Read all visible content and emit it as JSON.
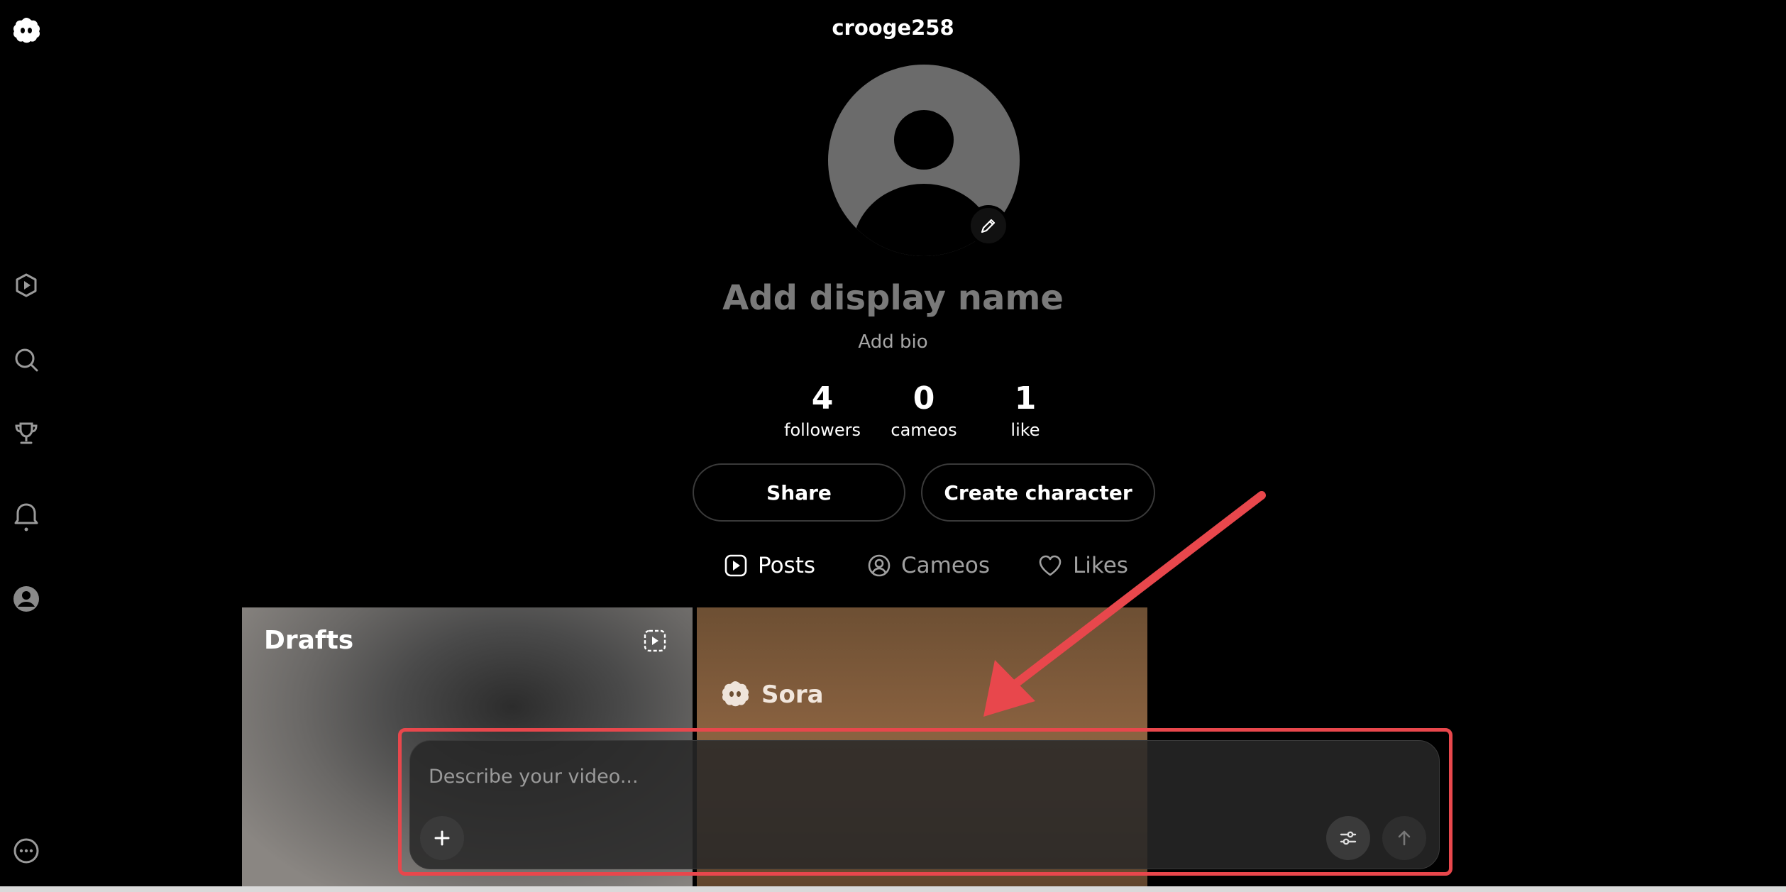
{
  "header": {
    "username": "crooge258"
  },
  "profile": {
    "display_name_placeholder": "Add display name",
    "bio_placeholder": "Add bio"
  },
  "stats": [
    {
      "value": "4",
      "label": "followers"
    },
    {
      "value": "0",
      "label": "cameos"
    },
    {
      "value": "1",
      "label": "like"
    }
  ],
  "actions": {
    "share_label": "Share",
    "create_character_label": "Create character"
  },
  "tabs": [
    {
      "label": "Posts",
      "icon": "play-square-icon",
      "active": true
    },
    {
      "label": "Cameos",
      "icon": "person-circle-icon",
      "active": false
    },
    {
      "label": "Likes",
      "icon": "heart-icon",
      "active": false
    }
  ],
  "grid": {
    "drafts_title": "Drafts",
    "sora_label": "Sora"
  },
  "composer": {
    "placeholder": "Describe your video..."
  },
  "sidebar": {
    "items": [
      "logo-icon",
      "feed-icon",
      "search-icon",
      "trophy-icon",
      "notifications-icon",
      "profile-icon",
      "more-icon"
    ]
  },
  "colors": {
    "highlight": "#e8474c",
    "background": "#000000",
    "muted_text": "#7a7a7a"
  }
}
